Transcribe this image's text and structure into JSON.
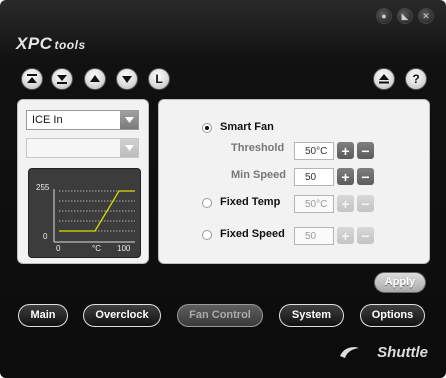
{
  "app": {
    "logo_prefix": "XPC",
    "logo_suffix": "tools",
    "brand": "Shuttle"
  },
  "window_controls": [
    {
      "name": "settings",
      "glyph": "●"
    },
    {
      "name": "minimize",
      "glyph": "◣"
    },
    {
      "name": "close",
      "glyph": "✕"
    }
  ],
  "toolbar": {
    "L_label": "L",
    "help_label": "?"
  },
  "left": {
    "sensor_select": "ICE In",
    "second_select": "",
    "graph": {
      "y_max": "255",
      "y_min": "0",
      "x_min": "0",
      "x_unit": "°C",
      "x_max": "100"
    }
  },
  "fan": {
    "smart_fan_label": "Smart Fan",
    "threshold_label": "Threshold",
    "threshold_value": "50°C",
    "min_speed_label": "Min Speed",
    "min_speed_value": "50",
    "fixed_temp_label": "Fixed Temp",
    "fixed_temp_value": "50°C",
    "fixed_speed_label": "Fixed Speed",
    "fixed_speed_value": "50",
    "plus": "+",
    "minus": "−"
  },
  "apply_label": "Apply",
  "nav": {
    "main": "Main",
    "overclock": "Overclock",
    "fan_control": "Fan Control",
    "system": "System",
    "options": "Options"
  },
  "colors": {
    "accent_curve": "#d4e000",
    "frame": "#111111"
  }
}
